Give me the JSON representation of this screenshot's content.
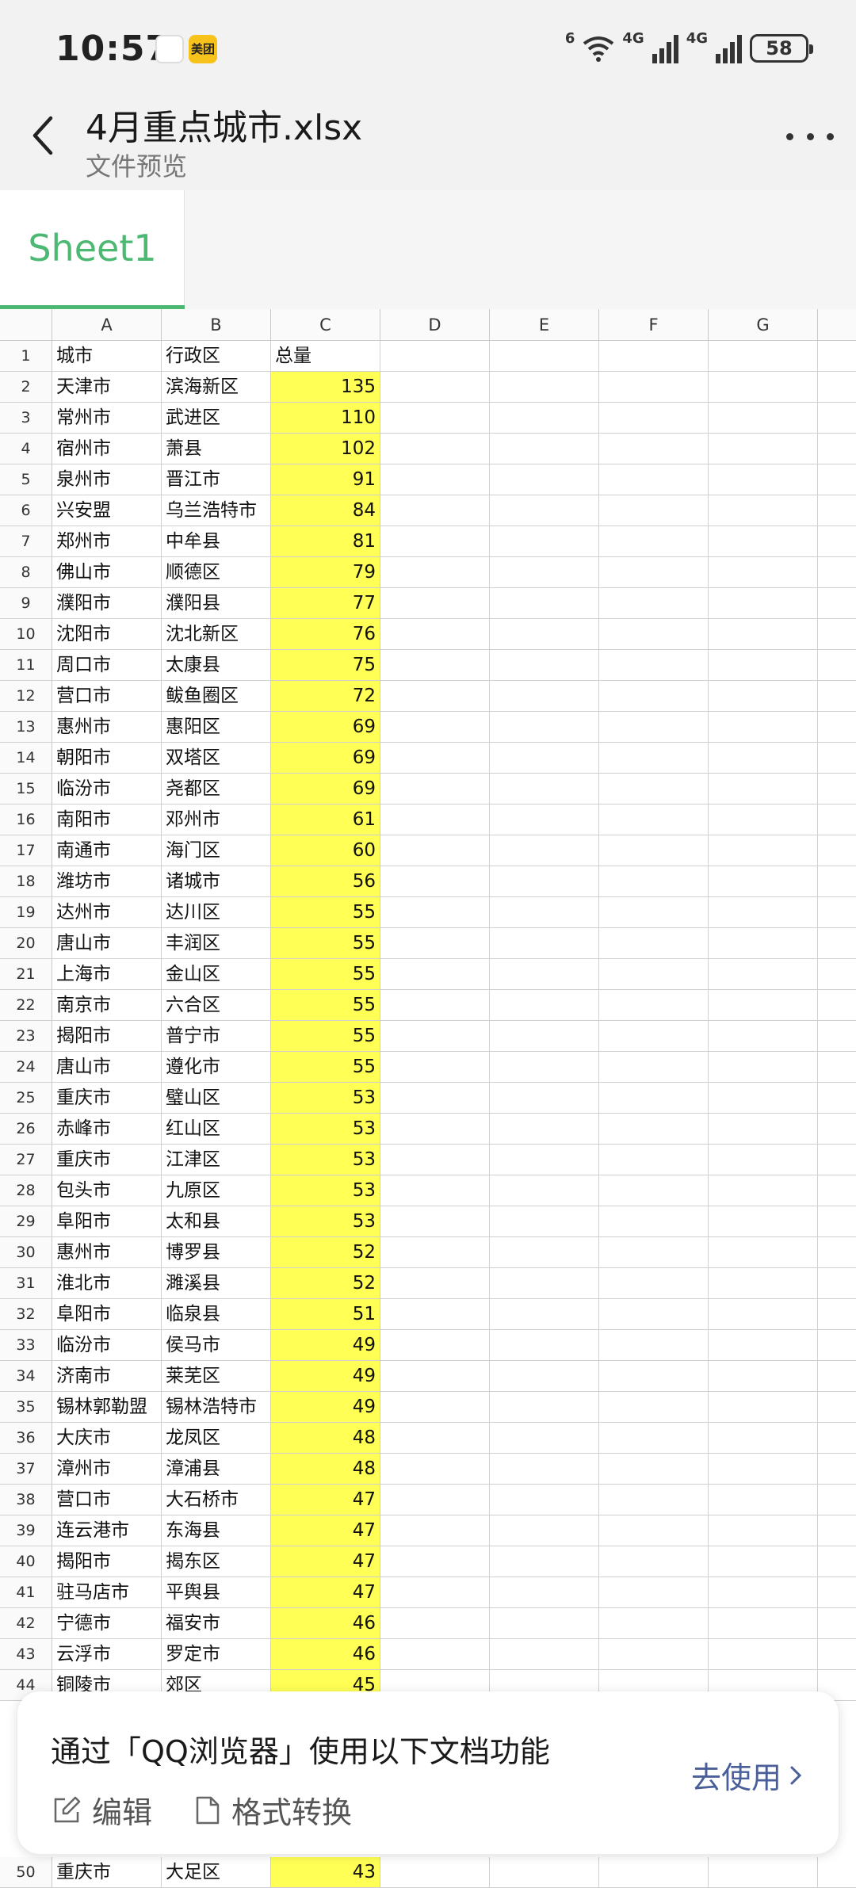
{
  "status_bar": {
    "time": "10:57",
    "app_icons": [
      "cat-app-icon",
      "meituan-icon"
    ],
    "meituan_label": "美团",
    "network_labels": [
      "6",
      "4G",
      "4G"
    ],
    "battery": "58"
  },
  "header": {
    "title": "4月重点城市.xlsx",
    "subtitle": "文件预览"
  },
  "sheet_tabs": [
    {
      "label": "Sheet1",
      "active": true
    }
  ],
  "accent_color": "#4cb872",
  "highlight_color": "#ffff55",
  "columns": [
    "A",
    "B",
    "C",
    "D",
    "E",
    "F",
    "G"
  ],
  "header_row": {
    "num": "1",
    "a": "城市",
    "b": "行政区",
    "c": "总量"
  },
  "rows": [
    {
      "num": "2",
      "a": "天津市",
      "b": "滨海新区",
      "c": "135"
    },
    {
      "num": "3",
      "a": "常州市",
      "b": "武进区",
      "c": "110"
    },
    {
      "num": "4",
      "a": "宿州市",
      "b": "萧县",
      "c": "102"
    },
    {
      "num": "5",
      "a": "泉州市",
      "b": "晋江市",
      "c": "91"
    },
    {
      "num": "6",
      "a": "兴安盟",
      "b": "乌兰浩特市",
      "c": "84"
    },
    {
      "num": "7",
      "a": "郑州市",
      "b": "中牟县",
      "c": "81"
    },
    {
      "num": "8",
      "a": "佛山市",
      "b": "顺德区",
      "c": "79"
    },
    {
      "num": "9",
      "a": "濮阳市",
      "b": "濮阳县",
      "c": "77"
    },
    {
      "num": "10",
      "a": "沈阳市",
      "b": "沈北新区",
      "c": "76"
    },
    {
      "num": "11",
      "a": "周口市",
      "b": "太康县",
      "c": "75"
    },
    {
      "num": "12",
      "a": "营口市",
      "b": "鲅鱼圈区",
      "c": "72"
    },
    {
      "num": "13",
      "a": "惠州市",
      "b": "惠阳区",
      "c": "69"
    },
    {
      "num": "14",
      "a": "朝阳市",
      "b": "双塔区",
      "c": "69"
    },
    {
      "num": "15",
      "a": "临汾市",
      "b": "尧都区",
      "c": "69"
    },
    {
      "num": "16",
      "a": "南阳市",
      "b": "邓州市",
      "c": "61"
    },
    {
      "num": "17",
      "a": "南通市",
      "b": "海门区",
      "c": "60"
    },
    {
      "num": "18",
      "a": "潍坊市",
      "b": "诸城市",
      "c": "56"
    },
    {
      "num": "19",
      "a": "达州市",
      "b": "达川区",
      "c": "55"
    },
    {
      "num": "20",
      "a": "唐山市",
      "b": "丰润区",
      "c": "55"
    },
    {
      "num": "21",
      "a": "上海市",
      "b": "金山区",
      "c": "55"
    },
    {
      "num": "22",
      "a": "南京市",
      "b": "六合区",
      "c": "55"
    },
    {
      "num": "23",
      "a": "揭阳市",
      "b": "普宁市",
      "c": "55"
    },
    {
      "num": "24",
      "a": "唐山市",
      "b": "遵化市",
      "c": "55"
    },
    {
      "num": "25",
      "a": "重庆市",
      "b": "璧山区",
      "c": "53"
    },
    {
      "num": "26",
      "a": "赤峰市",
      "b": "红山区",
      "c": "53"
    },
    {
      "num": "27",
      "a": "重庆市",
      "b": "江津区",
      "c": "53"
    },
    {
      "num": "28",
      "a": "包头市",
      "b": "九原区",
      "c": "53"
    },
    {
      "num": "29",
      "a": "阜阳市",
      "b": "太和县",
      "c": "53"
    },
    {
      "num": "30",
      "a": "惠州市",
      "b": "博罗县",
      "c": "52"
    },
    {
      "num": "31",
      "a": "淮北市",
      "b": "濉溪县",
      "c": "52"
    },
    {
      "num": "32",
      "a": "阜阳市",
      "b": "临泉县",
      "c": "51"
    },
    {
      "num": "33",
      "a": "临汾市",
      "b": "侯马市",
      "c": "49"
    },
    {
      "num": "34",
      "a": "济南市",
      "b": "莱芜区",
      "c": "49"
    },
    {
      "num": "35",
      "a": "锡林郭勒盟",
      "b": "锡林浩特市",
      "c": "49"
    },
    {
      "num": "36",
      "a": "大庆市",
      "b": "龙凤区",
      "c": "48"
    },
    {
      "num": "37",
      "a": "漳州市",
      "b": "漳浦县",
      "c": "48"
    },
    {
      "num": "38",
      "a": "营口市",
      "b": "大石桥市",
      "c": "47"
    },
    {
      "num": "39",
      "a": "连云港市",
      "b": "东海县",
      "c": "47"
    },
    {
      "num": "40",
      "a": "揭阳市",
      "b": "揭东区",
      "c": "47"
    },
    {
      "num": "41",
      "a": "驻马店市",
      "b": "平舆县",
      "c": "47"
    },
    {
      "num": "42",
      "a": "宁德市",
      "b": "福安市",
      "c": "46"
    },
    {
      "num": "43",
      "a": "云浮市",
      "b": "罗定市",
      "c": "46"
    },
    {
      "num": "44",
      "a": "铜陵市",
      "b": "郊区",
      "c": "45"
    }
  ],
  "bottom_row": {
    "num": "50",
    "a": "重庆市",
    "b": "大足区",
    "c": "43"
  },
  "popup": {
    "title": "通过「QQ浏览器」使用以下文档功能",
    "edit_label": "编辑",
    "convert_label": "格式转换",
    "go_label": "去使用"
  }
}
